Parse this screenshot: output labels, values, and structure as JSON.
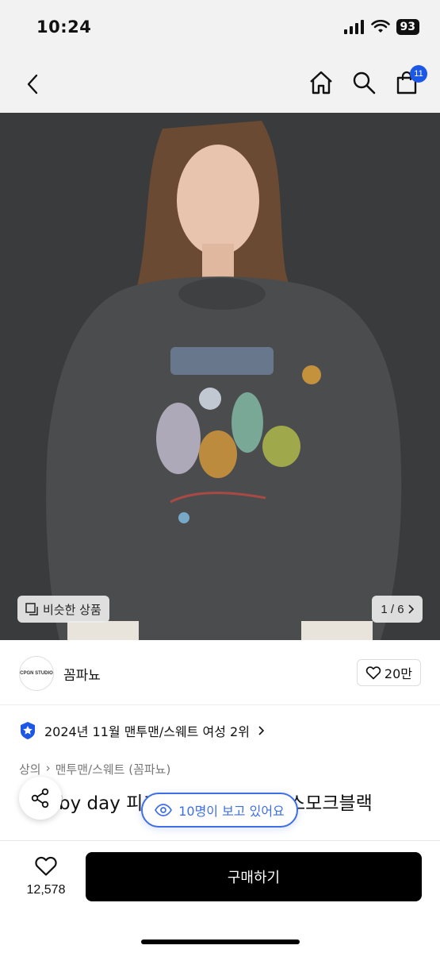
{
  "status": {
    "time": "10:24",
    "battery": "93"
  },
  "nav": {
    "cart_count": "11"
  },
  "gallery": {
    "similar_label": "비슷한 상품",
    "counter": "1 / 6"
  },
  "seller": {
    "name": "꼼파뇨",
    "logo_text": "CPGN STUDIO",
    "likes": "20만"
  },
  "product": {
    "ranking": "2024년 11월 맨투맨/스웨트 여성 2위",
    "breadcrumb": [
      "상의",
      "맨투맨/스웨트 (꼼파뇨)"
    ],
    "title_visible": "by day 피그",
    "title_visible_end": "스모크블랙",
    "viewers": "10명이 보고 있어요"
  },
  "bottom": {
    "wish_count": "12,578",
    "buy_label": "구매하기"
  },
  "colors": {
    "accent": "#1c57e6",
    "viewer_blue": "#3e6fe6",
    "buy_bg": "#000000"
  }
}
